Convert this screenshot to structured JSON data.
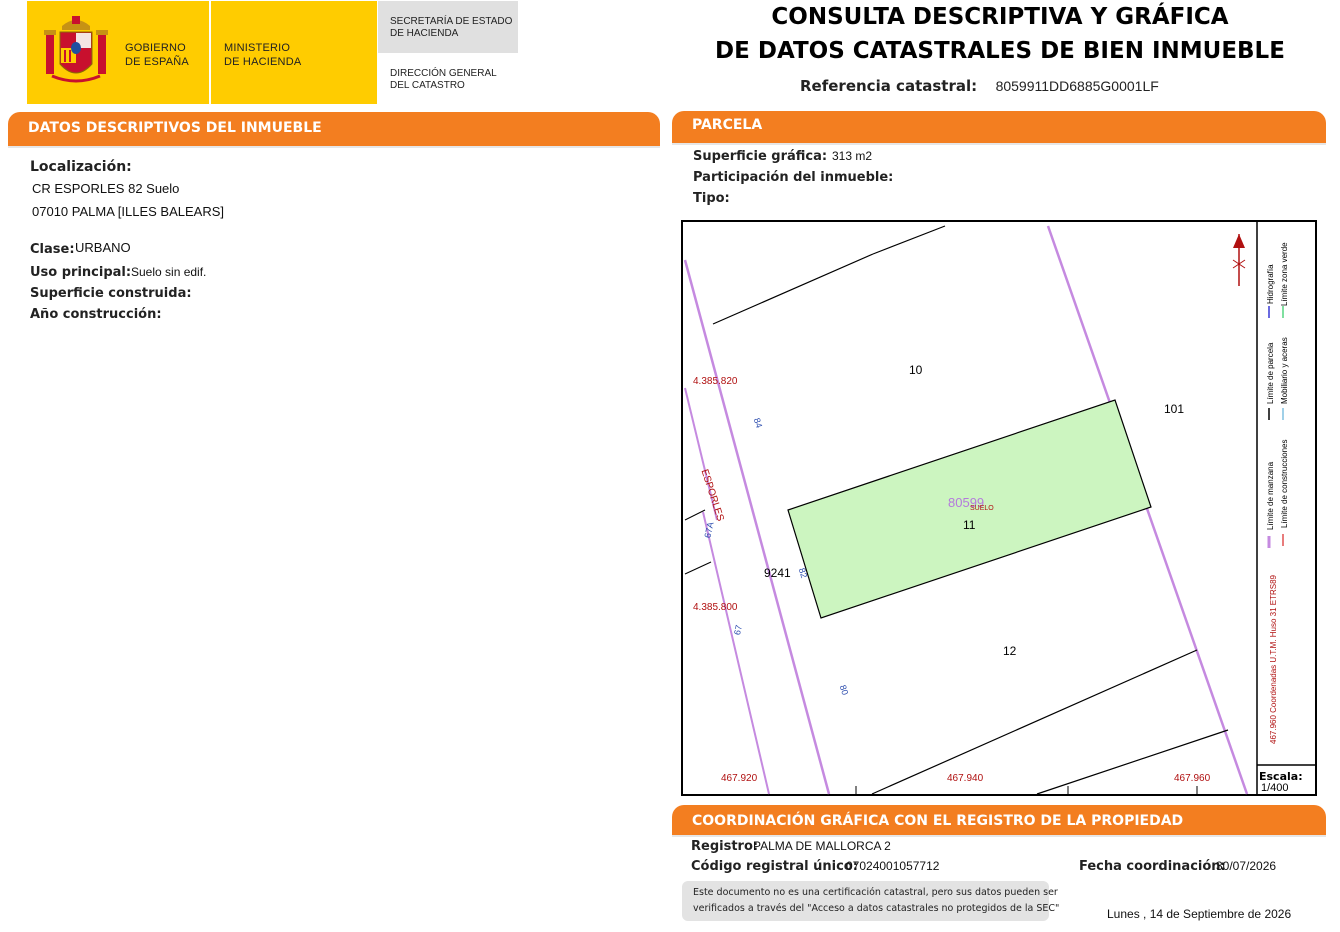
{
  "header": {
    "gov_line1": "GOBIERNO",
    "gov_line2": "DE ESPAÑA",
    "ministry_line1": "MINISTERIO",
    "ministry_line2": "DE HACIENDA",
    "secretaria_line1": "SECRETARÍA DE ESTADO",
    "secretaria_line2": "DE HACIENDA",
    "direccion_line1": "DIRECCIÓN GENERAL",
    "direccion_line2": "DEL CATASTRO",
    "title_line1": "CONSULTA DESCRIPTIVA Y GRÁFICA",
    "title_line2": "DE DATOS CATASTRALES DE BIEN INMUEBLE",
    "ref_label": "Referencia catastral:",
    "ref_value": "8059911DD6885G0001LF"
  },
  "descriptivos": {
    "section_title": "DATOS DESCRIPTIVOS DEL INMUEBLE",
    "localizacion_label": "Localización:",
    "address_line1": "CR ESPORLES 82 Suelo",
    "address_line2": "07010 PALMA [ILLES BALEARS]",
    "clase_label": "Clase:",
    "clase_value": "URBANO",
    "uso_label": "Uso principal:",
    "uso_value": "Suelo sin edif.",
    "superficie_construida_label": "Superficie construida:",
    "anio_label": "Año construcción:"
  },
  "parcela": {
    "section_title": "PARCELA",
    "superficie_label": "Superficie gráfica:",
    "superficie_value": "313 m2",
    "participacion_label": "Participación del inmueble:",
    "tipo_label": "Tipo:"
  },
  "map": {
    "parcel_ref": "80599",
    "parcel_use": "SUELO",
    "parcel_number": "11",
    "neighbor_10": "10",
    "neighbor_101": "101",
    "neighbor_12": "12",
    "block_9241": "9241",
    "street_name": "ESPORLES",
    "street_num_84": "84",
    "street_num_82": "82",
    "street_num_80": "80",
    "street_num_67a": "67A",
    "street_num_67": "67",
    "coord_y1": "4.385.820",
    "coord_y2": "4.385.800",
    "coord_x1": "467.920",
    "coord_x2": "467.940",
    "coord_x3": "467.960",
    "legend_manzana": "Límite de manzana",
    "legend_parcela": "Límite de parcela",
    "legend_hidrografia": "Hidrografía",
    "legend_construcciones": "Límite de construcciones",
    "legend_mobiliario": "Mobiliario y aceras",
    "legend_zona_verde": "Límite zona verde",
    "legend_coords": "467.960 Coordenadas U.T.M. Huso 31 ETRS89",
    "scale_label": "Escala:",
    "scale_value": "1/400"
  },
  "registro": {
    "section_title": "COORDINACIÓN GRÁFICA CON EL REGISTRO DE LA PROPIEDAD",
    "registro_label": "Registro:",
    "registro_value": "PALMA DE MALLORCA 2",
    "codigo_label": "Código registral único:",
    "codigo_value": "07024001057712",
    "fecha_label": "Fecha coordinación:",
    "fecha_value": "30/07/2026",
    "note_line1": "Este documento no es una certificación catastral, pero sus datos pueden ser",
    "note_line2": "verificados a través del \"Acceso a datos catastrales no protegidos de la SEC\"",
    "date_footer": "Lunes , 14 de Septiembre de 2026"
  },
  "colors": {
    "orange": "#f37e20",
    "yellow": "#ffcc00",
    "parcel_fill": "#ccf5c0",
    "manzana_line": "#c58ae0",
    "coord_red": "#b01010"
  }
}
